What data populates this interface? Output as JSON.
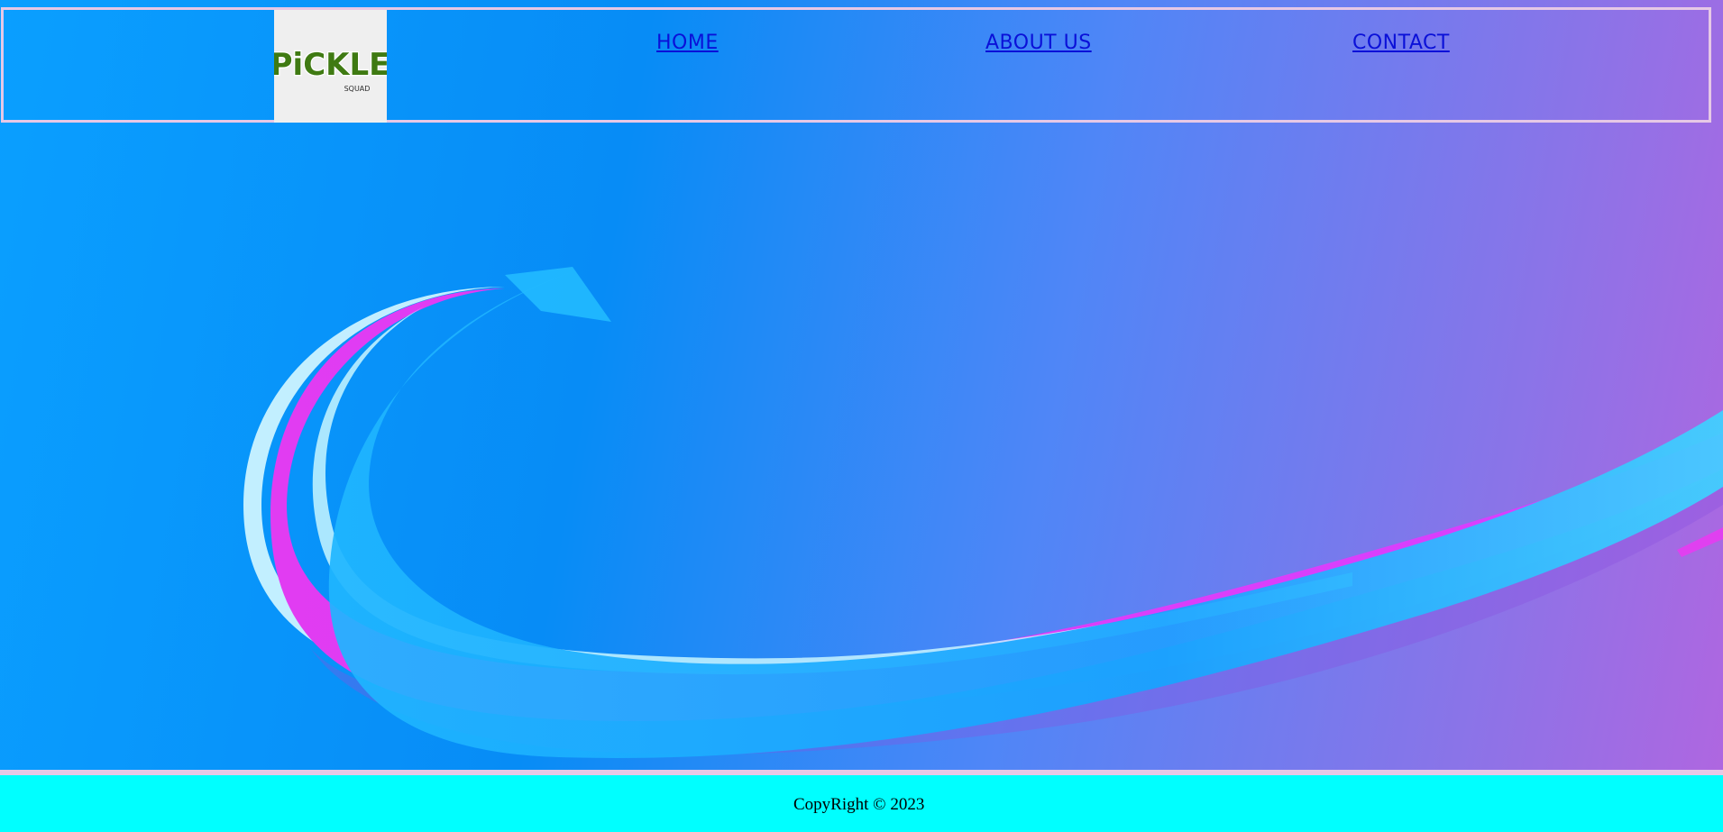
{
  "header": {
    "logo": {
      "word": "PiCKLE",
      "subword": "SQUAD",
      "icon": "pickle-mascot-icon"
    },
    "nav": [
      {
        "label": "HOME"
      },
      {
        "label": "ABOUT US"
      },
      {
        "label": "CONTACT"
      }
    ]
  },
  "hero": {
    "art": "abstract-ribbon-wave"
  },
  "footer": {
    "copyright": "CopyRight © 2023"
  },
  "colors": {
    "background_start": "#0a9fff",
    "background_end": "#b066e0",
    "ribbon_magenta": "#e040f0",
    "ribbon_cyan": "#19b4ff",
    "ribbon_highlight": "#c8f6ff",
    "nav_link": "#0a10d8",
    "border": "#e6c8e6",
    "footer_bg": "#00ffff",
    "logo_green": "#3f7a12"
  }
}
